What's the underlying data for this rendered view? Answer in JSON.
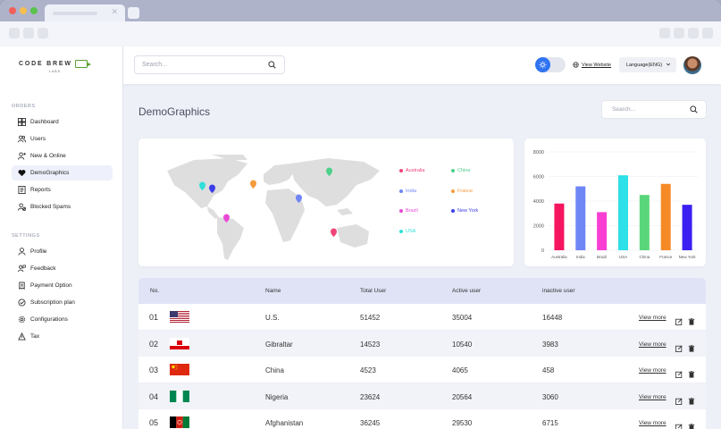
{
  "brand": {
    "name": "CODE BREW",
    "sub": "LABS",
    "accent": "#5aa031"
  },
  "header": {
    "search_placeholder": "Search...",
    "view_website": "View Website",
    "language": "Language(ENG)"
  },
  "sidebar": {
    "orders_label": "ORDERS",
    "settings_label": "SETTINGS",
    "orders": [
      {
        "label": "Dashboard",
        "icon": "grid-icon"
      },
      {
        "label": "Users",
        "icon": "users-icon"
      },
      {
        "label": "New & Online",
        "icon": "user-plus-icon"
      },
      {
        "label": "DemoGraphics",
        "icon": "heart-icon",
        "active": true
      },
      {
        "label": "Reports",
        "icon": "report-icon"
      },
      {
        "label": "Blocked Spams",
        "icon": "block-icon"
      }
    ],
    "settings": [
      {
        "label": "Profile",
        "icon": "person-icon"
      },
      {
        "label": "Feedback",
        "icon": "feedback-icon"
      },
      {
        "label": "Payment Option",
        "icon": "payment-icon"
      },
      {
        "label": "Subscription plan",
        "icon": "subscription-icon"
      },
      {
        "label": "Configurations",
        "icon": "config-icon"
      },
      {
        "label": "Tax",
        "icon": "tax-icon"
      }
    ]
  },
  "page": {
    "title": "DemoGraphics",
    "search_placeholder": "Search..."
  },
  "map_legend": [
    {
      "label": "Australia",
      "color": "#f0457a"
    },
    {
      "label": "China",
      "color": "#4cd08a"
    },
    {
      "label": "India",
      "color": "#6f86f5"
    },
    {
      "label": "France",
      "color": "#f59a3d"
    },
    {
      "label": "Brazil",
      "color": "#e84ad6"
    },
    {
      "label": "New York",
      "color": "#3b3dea"
    },
    {
      "label": "USA",
      "color": "#2ee0d8"
    }
  ],
  "chart_data": {
    "type": "bar",
    "categories": [
      "Australia",
      "India",
      "Brazil",
      "USA",
      "China",
      "France",
      "New York"
    ],
    "values": [
      3800,
      5200,
      3100,
      6100,
      4500,
      5400,
      3700
    ],
    "colors": [
      "#f5165f",
      "#6f86f5",
      "#f93ed3",
      "#2ee0e8",
      "#5ad67a",
      "#f58a26",
      "#3a1ff0"
    ],
    "yticks": [
      0,
      2000,
      4000,
      6000,
      8000
    ],
    "ylim": [
      0,
      8000
    ],
    "grid": true
  },
  "table": {
    "headers": {
      "no": "No.",
      "name": "Name",
      "total": "Total User",
      "active": "Active user",
      "inactive": "inactive user"
    },
    "view_more": "View more",
    "rows": [
      {
        "no": "01",
        "name": "U.S.",
        "total": "51452",
        "active": "35004",
        "inactive": "16448",
        "flag": "us"
      },
      {
        "no": "02",
        "name": "Gibraltar",
        "total": "14523",
        "active": "10540",
        "inactive": "3983",
        "flag": "gi"
      },
      {
        "no": "03",
        "name": "China",
        "total": "4523",
        "active": "4065",
        "inactive": "458",
        "flag": "cn"
      },
      {
        "no": "04",
        "name": "Nigeria",
        "total": "23624",
        "active": "20564",
        "inactive": "3060",
        "flag": "ng"
      },
      {
        "no": "05",
        "name": "Afghanistan",
        "total": "36245",
        "active": "29530",
        "inactive": "6715",
        "flag": "af"
      }
    ]
  }
}
